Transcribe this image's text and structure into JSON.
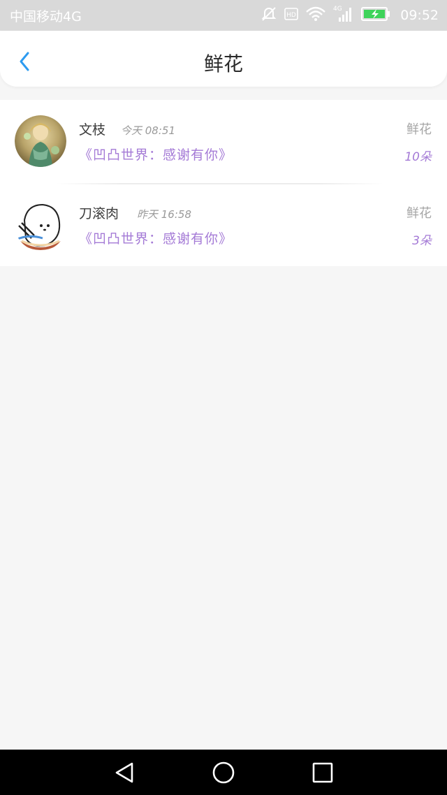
{
  "status_bar": {
    "carrier": "中国移动4G",
    "network_label": "4G",
    "time": "09:52",
    "icons": [
      "mute-icon",
      "hd-icon",
      "wifi-icon",
      "signal-icon",
      "battery-charging-icon"
    ]
  },
  "header": {
    "title": "鲜花",
    "back_icon": "chevron-left-icon"
  },
  "gifts": [
    {
      "name": "文枝",
      "time": "今天 08:51",
      "book": "《凹凸世界：感谢有你》",
      "gift": "鲜花",
      "count": "10朵"
    },
    {
      "name": "刀滚肉",
      "time": "昨天 16:58",
      "book": "《凹凸世界：感谢有你》",
      "gift": "鲜花",
      "count": "3朵"
    }
  ],
  "nav_bar": {
    "icons": [
      "back-triangle-icon",
      "home-circle-icon",
      "recents-square-icon"
    ]
  },
  "colors": {
    "accent_blue": "#2d9bf0",
    "accent_purple": "#a47ad6",
    "page_bg": "#f6f6f6"
  }
}
